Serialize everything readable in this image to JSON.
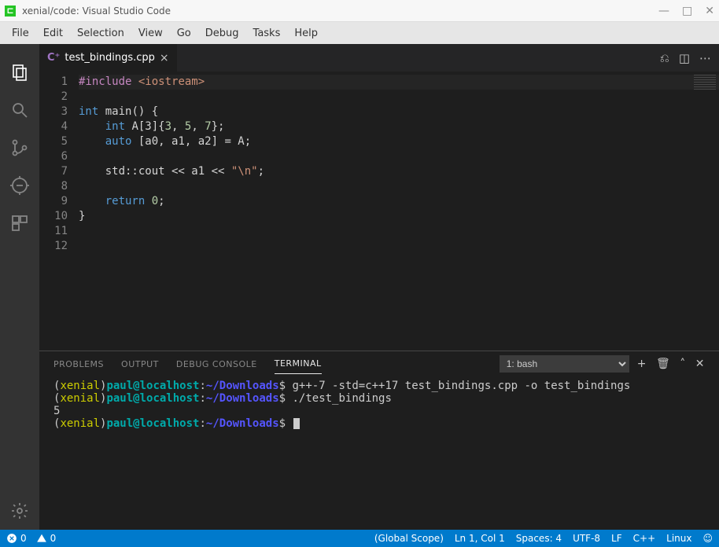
{
  "window": {
    "title": "xenial/code: Visual Studio Code"
  },
  "menu": [
    "File",
    "Edit",
    "Selection",
    "View",
    "Go",
    "Debug",
    "Tasks",
    "Help"
  ],
  "tab": {
    "filename": "test_bindings.cpp"
  },
  "code": {
    "lines": [
      {
        "n": "1",
        "html": "<span class='inc'>#include</span> <span class='str'>&lt;iostream&gt;</span>",
        "hl": true
      },
      {
        "n": "2",
        "html": ""
      },
      {
        "n": "3",
        "html": "<span class='kw'>int</span> main() {"
      },
      {
        "n": "4",
        "html": "    <span class='kw'>int</span> A[3]{<span class='num'>3</span>, <span class='num'>5</span>, <span class='num'>7</span>};"
      },
      {
        "n": "5",
        "html": "    <span class='kw'>auto</span> [a0, a1, a2] = A;"
      },
      {
        "n": "6",
        "html": ""
      },
      {
        "n": "7",
        "html": "    std::cout &lt;&lt; a1 &lt;&lt; <span class='str'>\"\\n\"</span>;"
      },
      {
        "n": "8",
        "html": ""
      },
      {
        "n": "9",
        "html": "    <span class='kw'>return</span> <span class='num'>0</span>;"
      },
      {
        "n": "10",
        "html": "}"
      },
      {
        "n": "11",
        "html": ""
      },
      {
        "n": "12",
        "html": ""
      }
    ]
  },
  "panel": {
    "tabs": [
      "PROBLEMS",
      "OUTPUT",
      "DEBUG CONSOLE",
      "TERMINAL"
    ],
    "active": "TERMINAL",
    "shell": "1: bash"
  },
  "terminal": {
    "lines": [
      "(<span class='yel'>xenial</span>)<span class='teal'>paul@localhost</span>:<span class='blu'>~/Downloads</span>$ g++-7 -std=c++17 test_bindings.cpp -o test_bindings",
      "(<span class='yel'>xenial</span>)<span class='teal'>paul@localhost</span>:<span class='blu'>~/Downloads</span>$ ./test_bindings",
      "5",
      "(<span class='yel'>xenial</span>)<span class='teal'>paul@localhost</span>:<span class='blu'>~/Downloads</span>$ <span class='cursor'></span>"
    ]
  },
  "status": {
    "errors": "0",
    "warnings": "0",
    "scope": "(Global Scope)",
    "pos": "Ln 1, Col 1",
    "spaces": "Spaces: 4",
    "enc": "UTF-8",
    "eol": "LF",
    "lang": "C++",
    "os": "Linux"
  }
}
